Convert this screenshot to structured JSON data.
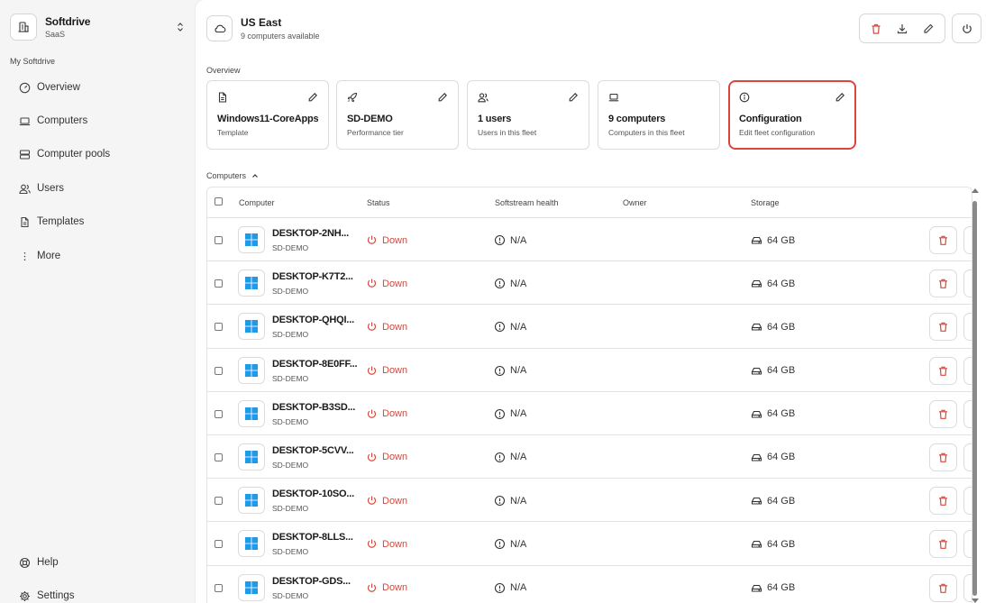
{
  "sidebar": {
    "org_name": "Softdrive",
    "org_plan": "SaaS",
    "section": "My Softdrive",
    "items": [
      {
        "label": "Overview",
        "icon": "gauge-icon"
      },
      {
        "label": "Computers",
        "icon": "laptop-icon"
      },
      {
        "label": "Computer pools",
        "icon": "server-icon"
      },
      {
        "label": "Users",
        "icon": "users-icon"
      },
      {
        "label": "Templates",
        "icon": "file-icon"
      },
      {
        "label": "More",
        "icon": "more-vertical-icon"
      }
    ],
    "bottom": [
      {
        "label": "Help",
        "icon": "lifebuoy-icon"
      },
      {
        "label": "Settings",
        "icon": "gear-icon"
      }
    ]
  },
  "header": {
    "title": "US East",
    "subtitle": "9 computers available"
  },
  "overview": {
    "label": "Overview",
    "cards": [
      {
        "title": "Windows11-CoreApps",
        "sub": "Template",
        "icon": "file-icon"
      },
      {
        "title": "SD-DEMO",
        "sub": "Performance tier",
        "icon": "rocket-icon"
      },
      {
        "title": "1 users",
        "sub": "Users in this fleet",
        "icon": "users-icon"
      },
      {
        "title": "9 computers",
        "sub": "Computers in this fleet",
        "icon": "laptop-icon"
      },
      {
        "title": "Configuration",
        "sub": "Edit fleet configuration",
        "icon": "info-icon"
      }
    ]
  },
  "computers": {
    "label": "Computers",
    "columns": {
      "computer": "Computer",
      "status": "Status",
      "health": "Softstream health",
      "owner": "Owner",
      "storage": "Storage"
    },
    "rows": [
      {
        "name": "DESKTOP-2NH...",
        "tier": "SD-DEMO",
        "status": "Down",
        "health": "N/A",
        "storage": "64 GB"
      },
      {
        "name": "DESKTOP-K7T2...",
        "tier": "SD-DEMO",
        "status": "Down",
        "health": "N/A",
        "storage": "64 GB"
      },
      {
        "name": "DESKTOP-QHQI...",
        "tier": "SD-DEMO",
        "status": "Down",
        "health": "N/A",
        "storage": "64 GB"
      },
      {
        "name": "DESKTOP-8E0FF...",
        "tier": "SD-DEMO",
        "status": "Down",
        "health": "N/A",
        "storage": "64 GB"
      },
      {
        "name": "DESKTOP-B3SD...",
        "tier": "SD-DEMO",
        "status": "Down",
        "health": "N/A",
        "storage": "64 GB"
      },
      {
        "name": "DESKTOP-5CVV...",
        "tier": "SD-DEMO",
        "status": "Down",
        "health": "N/A",
        "storage": "64 GB"
      },
      {
        "name": "DESKTOP-10SO...",
        "tier": "SD-DEMO",
        "status": "Down",
        "health": "N/A",
        "storage": "64 GB"
      },
      {
        "name": "DESKTOP-8LLS...",
        "tier": "SD-DEMO",
        "status": "Down",
        "health": "N/A",
        "storage": "64 GB"
      },
      {
        "name": "DESKTOP-GDS...",
        "tier": "SD-DEMO",
        "status": "Down",
        "health": "N/A",
        "storage": "64 GB"
      }
    ]
  },
  "colors": {
    "danger": "#d9473a",
    "windows": "#1e9be8",
    "border": "#dcdce0"
  }
}
